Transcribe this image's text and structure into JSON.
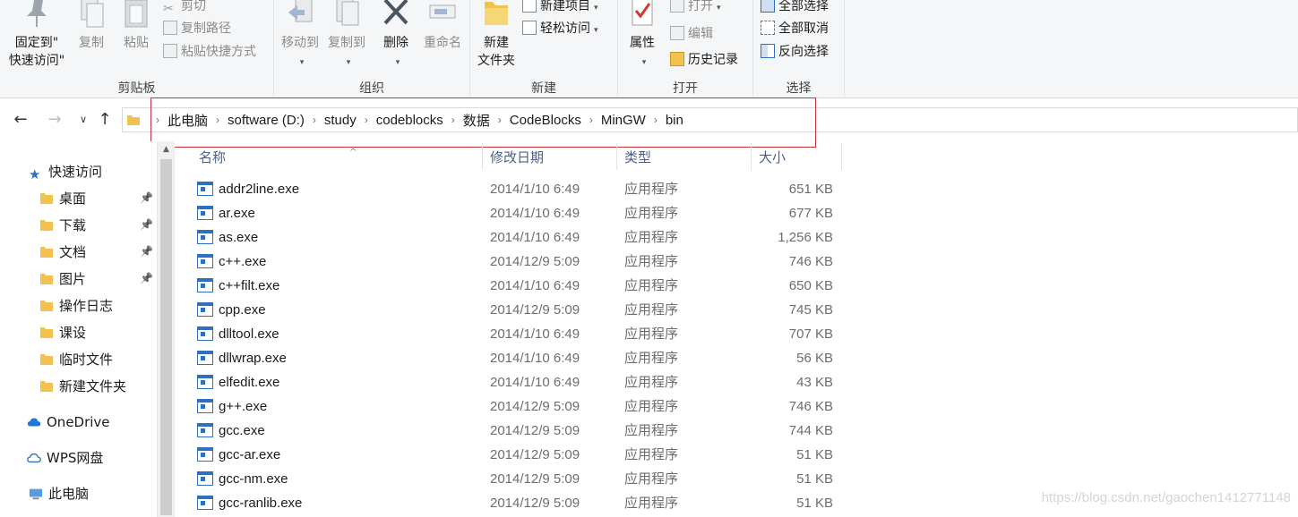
{
  "ribbon": {
    "clipboard": {
      "label": "剪贴板",
      "pin_label_line1": "固定到\"",
      "pin_label_line2": "快速访问\"",
      "copy": "复制",
      "paste": "粘贴",
      "cut": "剪切",
      "copy_path": "复制路径",
      "paste_shortcut": "粘贴快捷方式"
    },
    "organize": {
      "label": "组织",
      "move_to": "移动到",
      "copy_to": "复制到",
      "delete": "删除",
      "rename": "重命名"
    },
    "new": {
      "label": "新建",
      "new_folder_line1": "新建",
      "new_folder_line2": "文件夹",
      "new_item": "新建项目",
      "easy_access": "轻松访问"
    },
    "open": {
      "label": "打开",
      "properties": "属性",
      "open": "打开",
      "edit": "编辑",
      "history": "历史记录"
    },
    "select": {
      "label": "选择",
      "select_all": "全部选择",
      "select_none": "全部取消",
      "invert": "反向选择"
    }
  },
  "address": {
    "crumbs": [
      "此电脑",
      "software (D:)",
      "study",
      "codeblocks",
      "数据",
      "CodeBlocks",
      "MinGW",
      "bin"
    ]
  },
  "navpane": {
    "quick_access": "快速访问",
    "items": [
      {
        "label": "桌面",
        "pinned": true
      },
      {
        "label": "下载",
        "pinned": true
      },
      {
        "label": "文档",
        "pinned": true
      },
      {
        "label": "图片",
        "pinned": true
      },
      {
        "label": "操作日志",
        "pinned": false
      },
      {
        "label": "课设",
        "pinned": false
      },
      {
        "label": "临时文件",
        "pinned": false
      },
      {
        "label": "新建文件夹",
        "pinned": false
      }
    ],
    "onedrive": "OneDrive",
    "wps": "WPS网盘",
    "this_pc": "此电脑"
  },
  "columns": {
    "name": "名称",
    "date": "修改日期",
    "type": "类型",
    "size": "大小"
  },
  "files": [
    {
      "name": "addr2line.exe",
      "date": "2014/1/10 6:49",
      "type": "应用程序",
      "size": "651 KB"
    },
    {
      "name": "ar.exe",
      "date": "2014/1/10 6:49",
      "type": "应用程序",
      "size": "677 KB"
    },
    {
      "name": "as.exe",
      "date": "2014/1/10 6:49",
      "type": "应用程序",
      "size": "1,256 KB"
    },
    {
      "name": "c++.exe",
      "date": "2014/12/9 5:09",
      "type": "应用程序",
      "size": "746 KB"
    },
    {
      "name": "c++filt.exe",
      "date": "2014/1/10 6:49",
      "type": "应用程序",
      "size": "650 KB"
    },
    {
      "name": "cpp.exe",
      "date": "2014/12/9 5:09",
      "type": "应用程序",
      "size": "745 KB"
    },
    {
      "name": "dlltool.exe",
      "date": "2014/1/10 6:49",
      "type": "应用程序",
      "size": "707 KB"
    },
    {
      "name": "dllwrap.exe",
      "date": "2014/1/10 6:49",
      "type": "应用程序",
      "size": "56 KB"
    },
    {
      "name": "elfedit.exe",
      "date": "2014/1/10 6:49",
      "type": "应用程序",
      "size": "43 KB"
    },
    {
      "name": "g++.exe",
      "date": "2014/12/9 5:09",
      "type": "应用程序",
      "size": "746 KB"
    },
    {
      "name": "gcc.exe",
      "date": "2014/12/9 5:09",
      "type": "应用程序",
      "size": "744 KB"
    },
    {
      "name": "gcc-ar.exe",
      "date": "2014/12/9 5:09",
      "type": "应用程序",
      "size": "51 KB"
    },
    {
      "name": "gcc-nm.exe",
      "date": "2014/12/9 5:09",
      "type": "应用程序",
      "size": "51 KB"
    },
    {
      "name": "gcc-ranlib.exe",
      "date": "2014/12/9 5:09",
      "type": "应用程序",
      "size": "51 KB"
    }
  ],
  "watermark": "https://blog.csdn.net/gaochen1412771148",
  "colors": {
    "highlight_border": "#c8323a",
    "header_text": "#4d6185",
    "folder_yellow": "#f2c14e",
    "accent_blue": "#2f6fbf"
  }
}
